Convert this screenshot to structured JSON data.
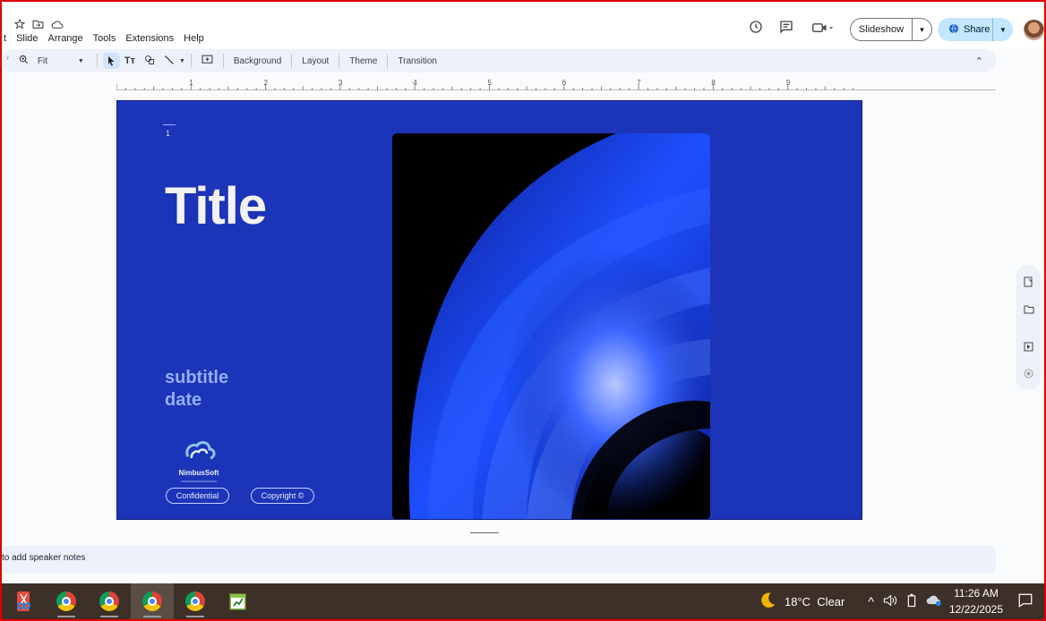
{
  "menu": [
    "t",
    "Slide",
    "Arrange",
    "Tools",
    "Extensions",
    "Help"
  ],
  "header": {
    "slideshow_label": "Slideshow",
    "share_label": "Share"
  },
  "toolbar": {
    "zoom": "Fit",
    "background": "Background",
    "layout": "Layout",
    "theme": "Theme",
    "transition": "Transition"
  },
  "ruler": [
    "1",
    "2",
    "3",
    "4",
    "5",
    "6",
    "7",
    "8",
    "9"
  ],
  "slide": {
    "page_number": "1",
    "title": "Title",
    "subtitle": "subtitle",
    "date": "date",
    "logo_text": "NimbusSoft",
    "pill_left": "Confidential",
    "pill_right": "Copyright ©",
    "background_color": "#1c34b8"
  },
  "notes": {
    "placeholder": "to add speaker notes"
  },
  "taskbar": {
    "weather": "18°C  Clear",
    "time": "11:26 AM",
    "date": "12/22/2025"
  }
}
